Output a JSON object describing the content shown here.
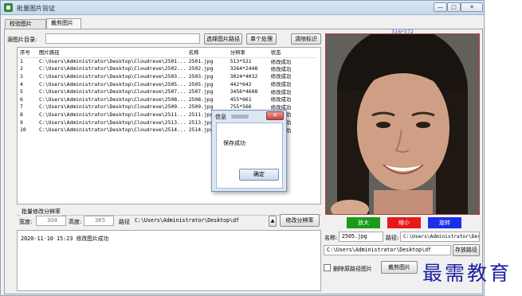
{
  "window": {
    "title": "批量图片验证",
    "min_glyph": "—",
    "max_glyph": "□",
    "close_glyph": "✕"
  },
  "tabs": [
    {
      "label": "校验图片"
    },
    {
      "label": "裁剪图片"
    }
  ],
  "source": {
    "label": "源图片目录:",
    "value": "",
    "select_button": "选择图片路径",
    "single_button": "单个处理",
    "clear_button": "清除标识"
  },
  "table": {
    "headers": [
      "序号",
      "图片路径",
      "名称",
      "分辨率",
      "状态"
    ],
    "rows": [
      [
        "1",
        "C:\\Users\\Administrator\\Desktop\\Cloudreve\\2501...",
        "2501.jpg",
        "513*521",
        "修改成功"
      ],
      [
        "2",
        "C:\\Users\\Administrator\\Desktop\\Cloudreve\\2502...",
        "2502.jpg",
        "3264*2448",
        "修改成功"
      ],
      [
        "3",
        "C:\\Users\\Administrator\\Desktop\\Cloudreve\\2503...",
        "2503.jpg",
        "3024*4032",
        "修改成功"
      ],
      [
        "4",
        "C:\\Users\\Administrator\\Desktop\\Cloudreve\\2505...",
        "2505.jpg",
        "442*642",
        "修改成功"
      ],
      [
        "5",
        "C:\\Users\\Administrator\\Desktop\\Cloudreve\\2507...",
        "2507.jpg",
        "3456*4608",
        "修改成功"
      ],
      [
        "6",
        "C:\\Users\\Administrator\\Desktop\\Cloudreve\\2508...",
        "2508.jpg",
        "455*661",
        "修改成功"
      ],
      [
        "7",
        "C:\\Users\\Administrator\\Desktop\\Cloudreve\\2509...",
        "2509.jpg",
        "755*566",
        "修改成功"
      ],
      [
        "8",
        "C:\\Users\\Administrator\\Desktop\\Cloudreve\\2511...",
        "2511.jpg",
        "",
        "修改成功"
      ],
      [
        "9",
        "C:\\Users\\Administrator\\Desktop\\Cloudreve\\2513...",
        "2513.jpg",
        "",
        "修改成功"
      ],
      [
        "10",
        "C:\\Users\\Administrator\\Desktop\\Cloudreve\\2514...",
        "2514.jpg",
        "",
        "修改成功"
      ]
    ]
  },
  "batch": {
    "group_title": "批量修改分辨率",
    "width_label": "宽度:",
    "width_value": "304",
    "height_label": "高度:",
    "height_value": "365",
    "path_label": "路径",
    "path_value": "C:\\Users\\Administrator\\Desktop\\df",
    "apply_button": "修改分辨率"
  },
  "log": {
    "line": "2020-11-10 15:23 修改图片成功"
  },
  "preview": {
    "dimension": "316*372",
    "zoom_in": "放大",
    "zoom_out": "缩小",
    "rotate": "旋转",
    "name_label": "名称:",
    "name_value": "2505.jpg",
    "path_label": "路径:",
    "path_value": "C:\\Users\\Administrator\\Desk",
    "save_path_value": "C:\\Users\\Administrator\\Desktop\\df",
    "save_path_button": "存放路径",
    "delete_checkbox_label": "删除原路径图片",
    "crop_button": "裁剪图片"
  },
  "dialog": {
    "title": "信息",
    "close_glyph": "✕",
    "message": "保存成功",
    "ok_button": "确定"
  },
  "watermark": {
    "text": "最需教育"
  },
  "colors": {
    "zoom_in": "#1a9a1a",
    "zoom_out": "#e81818",
    "rotate": "#1a30e8",
    "crop_border": "#e03030"
  }
}
